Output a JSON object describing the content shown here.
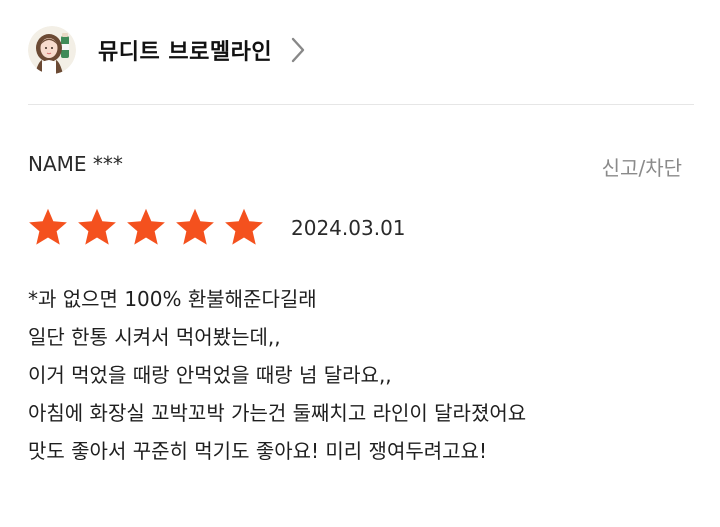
{
  "brand": {
    "name": "뮤디트 브로멜라인"
  },
  "review": {
    "reviewer": "NAME ***",
    "report_label": "신고/차단",
    "rating": 5,
    "rating_max": 5,
    "date": "2024.03.01",
    "lines": [
      "*과 없으면 100% 환불해준다길래",
      "일단 한통 시켜서 먹어봤는데,,",
      "이거 먹었을 때랑 안먹었을 때랑 넘 달라요,,",
      "아침에 화장실 꼬박꼬박 가는건 둘째치고 라인이 달라졌어요",
      "맛도 좋아서 꾸준히 먹기도 좋아요! 미리 쟁여두려고요!"
    ]
  },
  "colors": {
    "star": "#f4511e",
    "divider": "#e6e6e6",
    "muted_text": "#8a8a8a"
  },
  "icons": {
    "profile": "avatar",
    "more": "chevron-right-icon",
    "rating": "star-icon"
  }
}
